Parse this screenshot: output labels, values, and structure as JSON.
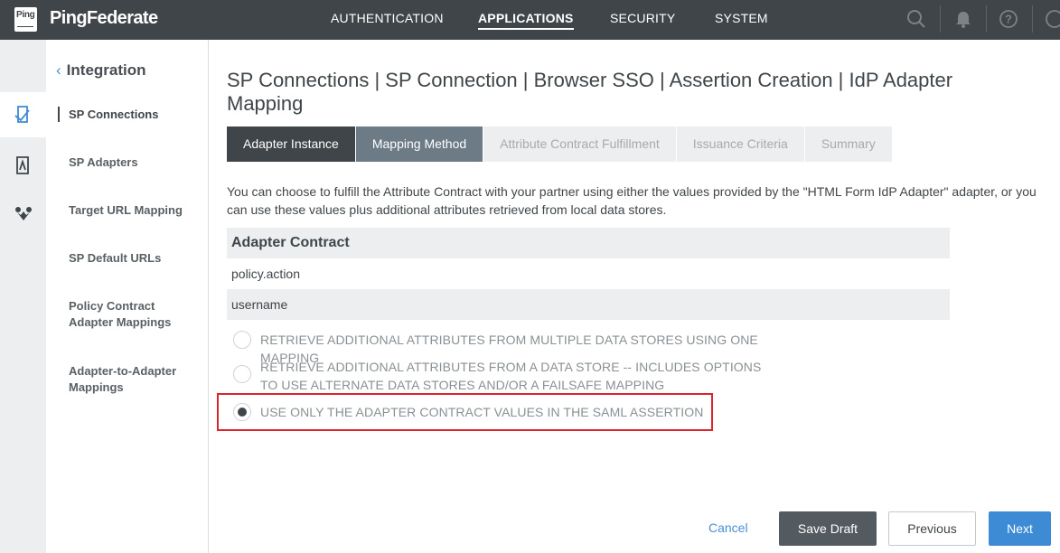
{
  "brand": {
    "logo_text": "Ping",
    "name": "PingFederate"
  },
  "nav": {
    "items": [
      {
        "label": "AUTHENTICATION"
      },
      {
        "label": "APPLICATIONS"
      },
      {
        "label": "SECURITY"
      },
      {
        "label": "SYSTEM"
      }
    ],
    "active": "APPLICATIONS"
  },
  "rail_icons": [
    "applications-icon",
    "document-user-icon",
    "shield-group-icon"
  ],
  "subnav": {
    "back_label": "Integration",
    "back_chevron": "‹",
    "items": [
      {
        "label": "SP Connections"
      },
      {
        "label": "SP Adapters"
      },
      {
        "label": "Target URL Mapping"
      },
      {
        "label": "SP Default URLs"
      },
      {
        "label": "Policy Contract Adapter Mappings"
      },
      {
        "label": "Adapter-to-Adapter Mappings"
      }
    ]
  },
  "breadcrumb": "SP Connections  |  SP Connection  |  Browser SSO  |  Assertion Creation  |  IdP Adapter Mapping",
  "tabs": [
    {
      "label": "Adapter Instance",
      "state": "done"
    },
    {
      "label": "Mapping Method",
      "state": "current"
    },
    {
      "label": "Attribute Contract Fulfillment",
      "state": "pending"
    },
    {
      "label": "Issuance Criteria",
      "state": "pending"
    },
    {
      "label": "Summary",
      "state": "pending"
    }
  ],
  "description": "You can choose to fulfill the Attribute Contract with your partner using either the values provided by the \"HTML Form IdP Adapter\" adapter, or you can use these values plus additional attributes retrieved from local data stores.",
  "contract": {
    "header": "Adapter Contract",
    "rows": [
      "policy.action",
      "username"
    ]
  },
  "options": [
    {
      "label": "RETRIEVE ADDITIONAL ATTRIBUTES FROM MULTIPLE DATA STORES USING ONE MAPPING",
      "checked": false
    },
    {
      "label": "RETRIEVE ADDITIONAL ATTRIBUTES FROM A DATA STORE -- INCLUDES OPTIONS TO USE ALTERNATE DATA STORES AND/OR A FAILSAFE MAPPING",
      "checked": false
    },
    {
      "label": "USE ONLY THE ADAPTER CONTRACT VALUES IN THE SAML ASSERTION",
      "checked": true
    }
  ],
  "footer": {
    "cancel": "Cancel",
    "save_draft": "Save Draft",
    "previous": "Previous",
    "next": "Next"
  },
  "colors": {
    "topbar": "#3f4549",
    "primary": "#3d8bd4",
    "highlight": "#d9262c"
  }
}
